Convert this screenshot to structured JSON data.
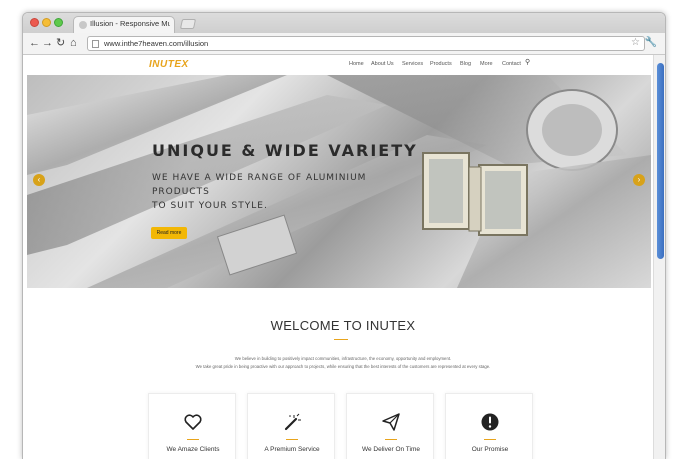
{
  "browser": {
    "tab_title": "Illusion - Responsive Multi",
    "url": "www.inthe7heaven.com/illusion",
    "back_icon": "back-arrow-icon",
    "forward_icon": "forward-arrow-icon",
    "reload_icon": "reload-icon",
    "home_icon": "home-icon",
    "star_icon": "star-icon",
    "wrench_icon": "wrench-icon"
  },
  "site": {
    "logo": "INUTEX",
    "menu": [
      "Home",
      "About Us",
      "Services",
      "Products",
      "Blog",
      "More",
      "Contact"
    ],
    "search_icon": "search-icon"
  },
  "hero": {
    "heading": "UNIQUE & WIDE VARIETY",
    "subheading_line1": "WE HAVE A WIDE RANGE OF ALUMINIUM PRODUCTS",
    "subheading_line2": "TO SUIT YOUR STYLE.",
    "button": "Read more",
    "prev_icon": "chevron-left-icon",
    "next_icon": "chevron-right-icon"
  },
  "welcome": {
    "title": "WELCOME TO INUTEX",
    "line1": "We believe in building to positively impact communities, infrastructure, the economy, opportunity and employment.",
    "line2": "We take great pride in being proactive with our approach to projects, while ensuring that the best interests of the customers are represented at every stage."
  },
  "features": [
    {
      "label": "We Amaze Clients",
      "icon": "heart-icon"
    },
    {
      "label": "A Premium Service",
      "icon": "magic-wand-icon"
    },
    {
      "label": "We Deliver On Time",
      "icon": "paper-plane-icon"
    },
    {
      "label": "Our Promise",
      "icon": "exclamation-circle-icon"
    }
  ],
  "colors": {
    "accent": "#e8a41c",
    "button": "#f2b705",
    "scroll_thumb": "#3b6fc0"
  }
}
